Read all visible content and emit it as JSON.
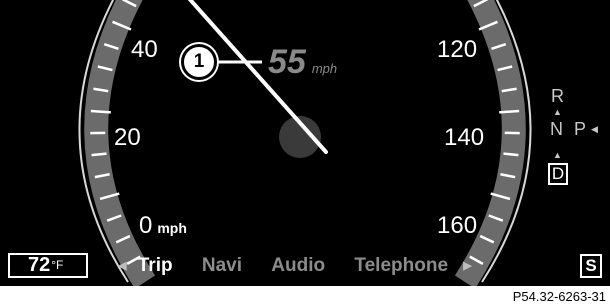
{
  "speedometer": {
    "left_scale": [
      "40",
      "20",
      "0"
    ],
    "left_unit": "mph",
    "right_scale": [
      "120",
      "140",
      "160"
    ]
  },
  "callout_number": "1",
  "cruise": {
    "value": "55",
    "unit": "mph"
  },
  "transmission": {
    "gears": [
      "R",
      "N",
      "D"
    ],
    "park": "P",
    "selected": "D"
  },
  "outside_temp": {
    "value": "72",
    "unit": "°F"
  },
  "menu": {
    "items": [
      "Trip",
      "Navi",
      "Audio",
      "Telephone"
    ],
    "active": "Trip"
  },
  "status_indicator": "S",
  "caption": "P54.32-6263-31",
  "colors": {
    "background": "#000000",
    "active_text": "#ffffff",
    "inactive_text": "#8c8c8c",
    "cruise_text": "#8a8a8a"
  }
}
